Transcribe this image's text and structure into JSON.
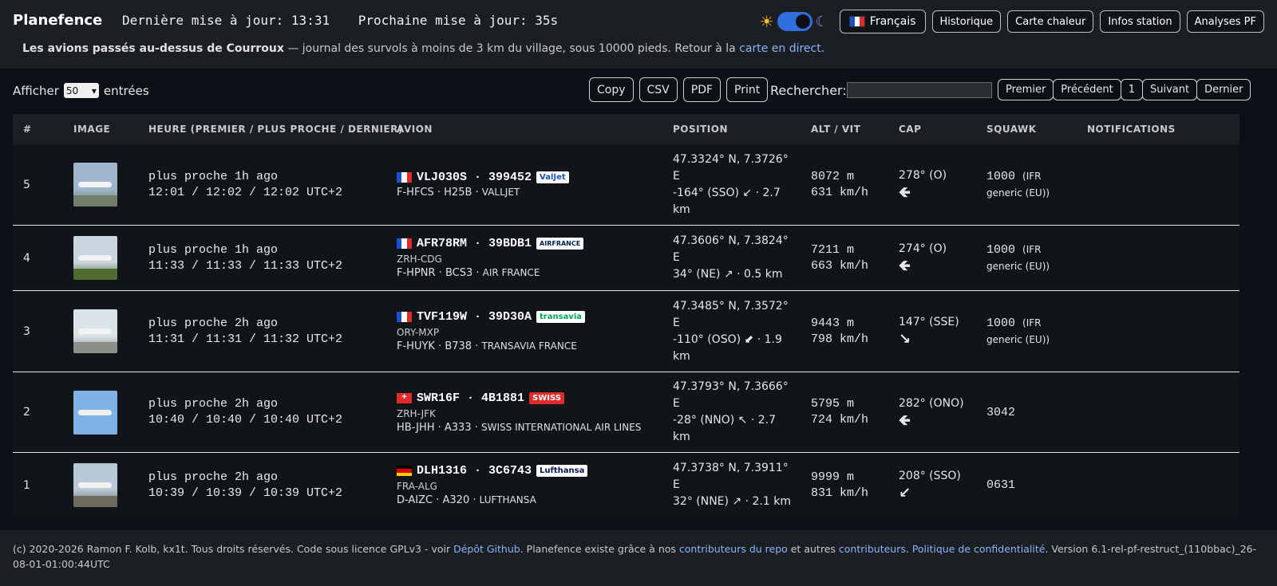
{
  "header": {
    "brand": "Planefence",
    "last_update": "Dernière mise à jour: 13:31",
    "next_update": "Prochaine mise à jour: 35s",
    "language": "Français",
    "nav": [
      "Historique",
      "Carte chaleur",
      "Infos station",
      "Analyses PF"
    ],
    "subtitle_bold": "Les avions passés au-dessus de Courroux",
    "subtitle_text": " — journal des survols à moins de 3 km du village, sous 10000 pieds. Retour à la ",
    "subtitle_link": "carte en direct",
    "subtitle_end": "."
  },
  "toolbar": {
    "show_label": "Afficher",
    "show_value": "50",
    "entries_label": "entrées",
    "export_buttons": [
      "Copy",
      "CSV",
      "PDF",
      "Print"
    ],
    "search_label": "Rechercher:",
    "pagination": [
      "Premier",
      "Précédent",
      "1",
      "Suivant",
      "Dernier"
    ]
  },
  "table": {
    "columns": [
      "#",
      "IMAGE",
      "HEURE (PREMIER / PLUS PROCHE / DERNIER)",
      "AVION",
      "POSITION",
      "ALT / VIT",
      "CAP",
      "SQUAWK",
      "NOTIFICATIONS"
    ],
    "rows": [
      {
        "num": "5",
        "time1": "plus proche 1h ago",
        "time2": "12:01 / 12:02 / 12:02 UTC+2",
        "callsign": "VLJ030S · 399452",
        "flag": "fr",
        "logo": "ValJet",
        "route": "",
        "reg": "F-HFCS · H25B · ",
        "operator": "VALLJET",
        "pos1": "47.3324° N, 7.3726°",
        "pos2": "E",
        "pos3": "-164° (SSO) ↙ · 2.7",
        "pos4": "km",
        "alt": "8072 m",
        "spd": "631 km/h",
        "cap": "278° (O)",
        "cap_arrow": "🡸",
        "squawk": "1000",
        "squawk_desc": "(IFR generic (EU))",
        "notif": ""
      },
      {
        "num": "4",
        "time1": "plus proche 1h ago",
        "time2": "11:33 / 11:33 / 11:33 UTC+2",
        "callsign": "AFR78RM · 39BDB1",
        "flag": "fr",
        "logo": "AIRFRANCE",
        "route": "ZRH-CDG",
        "reg": "F-HPNR · BCS3 · ",
        "operator": "AIR FRANCE",
        "pos1": "47.3606° N, 7.3824°",
        "pos2": "E",
        "pos3": "34° (NE) ↗ · 0.5 km",
        "pos4": "",
        "alt": "7211 m",
        "spd": "663 km/h",
        "cap": "274° (O)",
        "cap_arrow": "🡸",
        "squawk": "1000",
        "squawk_desc": "(IFR generic (EU))",
        "notif": ""
      },
      {
        "num": "3",
        "time1": "plus proche 2h ago",
        "time2": "11:31 / 11:31 / 11:32 UTC+2",
        "callsign": "TVF119W · 39D30A",
        "flag": "fr",
        "logo": "transavia",
        "route": "ORY-MXP",
        "reg": "F-HUYK · B738 · ",
        "operator": "TRANSAVIA FRANCE",
        "pos1": "47.3485° N, 7.3572°",
        "pos2": "E",
        "pos3": "-110° (OSO) ⬋ · 1.9",
        "pos4": "km",
        "alt": "9443 m",
        "spd": "798 km/h",
        "cap": "147° (SSE)",
        "cap_arrow": "↘",
        "squawk": "1000",
        "squawk_desc": "(IFR generic (EU))",
        "notif": ""
      },
      {
        "num": "2",
        "time1": "plus proche 2h ago",
        "time2": "10:40 / 10:40 / 10:40 UTC+2",
        "callsign": "SWR16F · 4B1881",
        "flag": "ch",
        "logo": "SWISS",
        "route": "ZRH-JFK",
        "reg": "HB-JHH · A333 · ",
        "operator": "SWISS INTERNATIONAL AIR LINES",
        "pos1": "47.3793° N, 7.3666°",
        "pos2": "E",
        "pos3": "-28° (NNO) ↖ · 2.7",
        "pos4": "km",
        "alt": "5795 m",
        "spd": "724 km/h",
        "cap": "282° (ONO)",
        "cap_arrow": "🡸",
        "squawk": "3042",
        "squawk_desc": "",
        "notif": ""
      },
      {
        "num": "1",
        "time1": "plus proche 2h ago",
        "time2": "10:39 / 10:39 / 10:39 UTC+2",
        "callsign": "DLH1316 · 3C6743",
        "flag": "de",
        "logo": "Lufthansa",
        "route": "FRA-ALG",
        "reg": "D-AIZC · A320 · ",
        "operator": "LUFTHANSA",
        "pos1": "47.3738° N, 7.3911°",
        "pos2": "E",
        "pos3": "32° (NNE) ↗ · 2.1 km",
        "pos4": "",
        "alt": "9999 m",
        "spd": "831 km/h",
        "cap": "208° (SSO)",
        "cap_arrow": "↙",
        "squawk": "0631",
        "squawk_desc": "",
        "notif": ""
      }
    ]
  },
  "footer": {
    "t1": "(c) 2020-2026 Ramon F. Kolb, kx1t. Tous droits réservés. Code sous licence GPLv3 - voir ",
    "l1": "Dépôt Github",
    "t2": ". Planefence existe grâce à nos ",
    "l2": "contributeurs du repo",
    "t3": " et autres ",
    "l3": "contributeurs",
    "t4": ". ",
    "l4": "Politique de confidentialité",
    "t5": ". Version 6.1-rel-pf-restruct_(110bbac)_26-08-01-01:00:44UTC"
  },
  "colors": {
    "background": "#0d1117",
    "header": "#1b1e23",
    "link": "#8ab4f8",
    "toggle": "#2f6fde"
  }
}
